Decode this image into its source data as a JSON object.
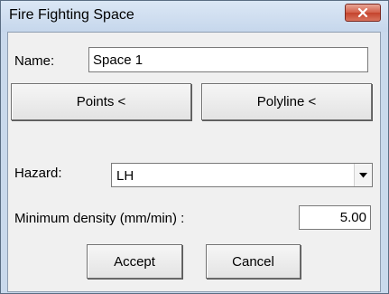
{
  "window": {
    "title": "Fire Fighting Space",
    "close_icon": "close-icon"
  },
  "form": {
    "name_label": "Name:",
    "name_value": "Space 1",
    "points_button": "Points <",
    "polyline_button": "Polyline <",
    "hazard_label": "Hazard:",
    "hazard_value": "LH",
    "density_label": "Minimum density (mm/min) :",
    "density_value": "5.00",
    "accept_button": "Accept",
    "cancel_button": "Cancel"
  },
  "colors": {
    "titlebar": "#c6d7ec",
    "close_button": "#c4432c",
    "client_background": "#f0f0f0"
  }
}
